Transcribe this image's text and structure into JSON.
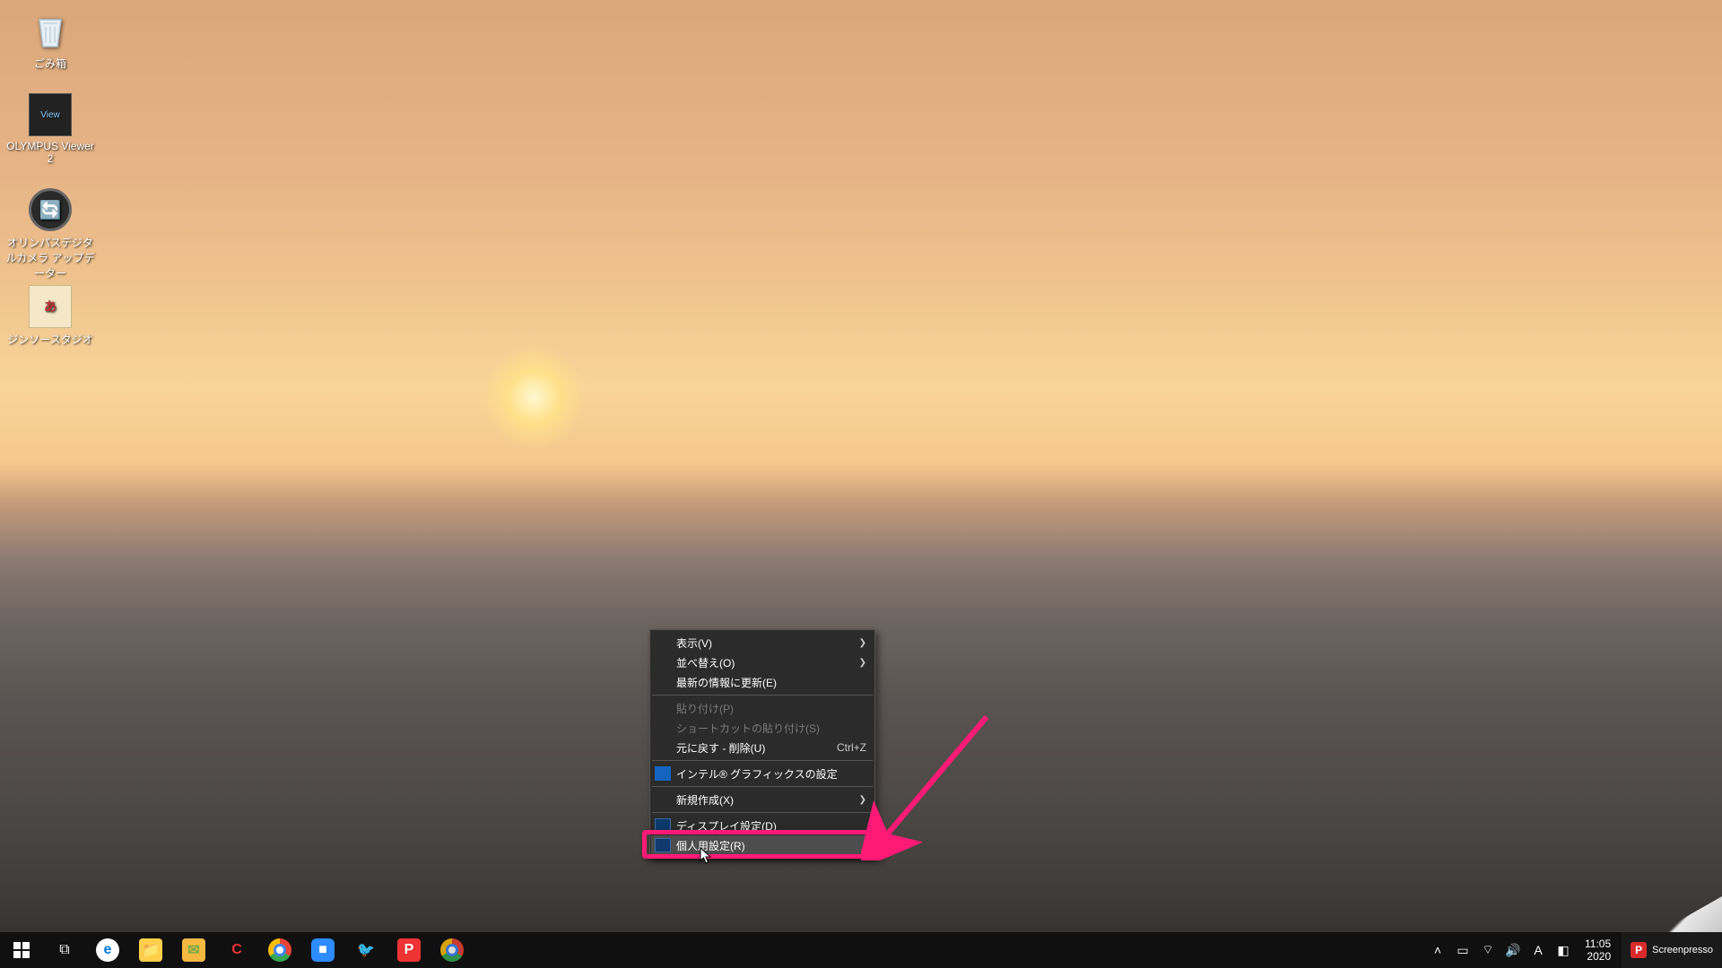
{
  "desktop_icons": {
    "recycle_bin": "ごみ箱",
    "olympus_viewer": "OLYMPUS Viewer 2",
    "olympus_updater": "オリンパスデジタルカメラ アップデーター",
    "jinsou_studio": "ジンソースタジオ"
  },
  "context_menu": {
    "view": "表示(V)",
    "sort": "並べ替え(O)",
    "refresh": "最新の情報に更新(E)",
    "paste": "貼り付け(P)",
    "paste_shortcut": "ショートカットの貼り付け(S)",
    "undo": "元に戻す - 削除(U)",
    "undo_shortcut": "Ctrl+Z",
    "intel": "インテル® グラフィックスの設定",
    "new": "新規作成(X)",
    "display": "ディスプレイ設定(D)",
    "personalize": "個人用設定(R)"
  },
  "taskbar": {
    "time": "11:05",
    "date": "2020",
    "ime": "A",
    "screenpresso": "Screenpresso"
  }
}
